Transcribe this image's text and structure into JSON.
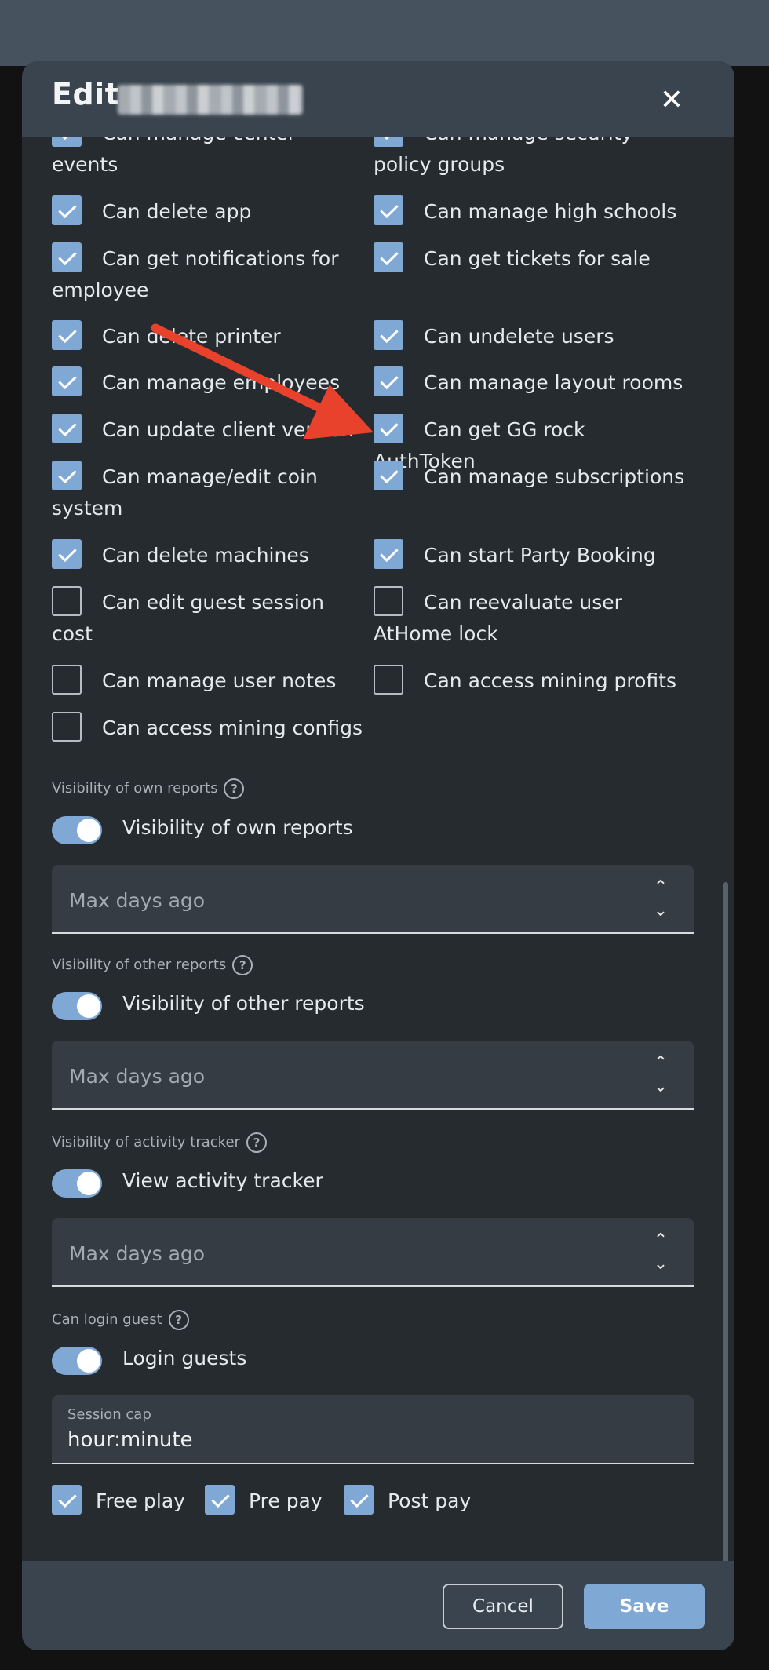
{
  "dialog": {
    "title": "Edit",
    "close_icon": "close-icon"
  },
  "permissions": [
    {
      "label": "Can manage center events",
      "checked": true
    },
    {
      "label": "Can manage security policy groups",
      "checked": true
    },
    {
      "label": "Can delete app",
      "checked": true
    },
    {
      "label": "Can manage high schools",
      "checked": true
    },
    {
      "label": "Can get notifications for employee",
      "checked": true
    },
    {
      "label": "Can get tickets for sale",
      "checked": true
    },
    {
      "label": "Can delete printer",
      "checked": true
    },
    {
      "label": "Can undelete users",
      "checked": true
    },
    {
      "label": "Can manage employees",
      "checked": true
    },
    {
      "label": "Can manage layout rooms",
      "checked": true
    },
    {
      "label": "Can update client version",
      "checked": true
    },
    {
      "label": "Can get GG rock AuthToken",
      "checked": true
    },
    {
      "label": "Can manage/edit coin system",
      "checked": true
    },
    {
      "label": "Can manage subscriptions",
      "checked": true
    },
    {
      "label": "Can delete machines",
      "checked": true
    },
    {
      "label": "Can start Party Booking",
      "checked": true
    },
    {
      "label": "Can edit guest session cost",
      "checked": false
    },
    {
      "label": "Can reevaluate user AtHome lock",
      "checked": false
    },
    {
      "label": "Can manage user notes",
      "checked": false
    },
    {
      "label": "Can access mining profits",
      "checked": false
    },
    {
      "label": "Can access mining configs",
      "checked": false
    }
  ],
  "sections": {
    "own_reports": {
      "label": "Visibility of own reports",
      "toggle_label": "Visibility of own reports",
      "enabled": true,
      "placeholder": "Max days ago"
    },
    "other_reports": {
      "label": "Visibility of other reports",
      "toggle_label": "Visibility of other reports",
      "enabled": true,
      "placeholder": "Max days ago"
    },
    "activity_tracker": {
      "label": "Visibility of activity tracker",
      "toggle_label": "View activity tracker",
      "enabled": true,
      "placeholder": "Max days ago"
    },
    "login_guest": {
      "label": "Can login guest",
      "toggle_label": "Login guests",
      "enabled": true,
      "session_cap_label": "Session cap",
      "session_cap_value": "hour:minute"
    }
  },
  "help_glyph": "?",
  "payment_options": [
    {
      "label": "Free play",
      "checked": true
    },
    {
      "label": "Pre pay",
      "checked": true
    },
    {
      "label": "Post pay",
      "checked": true
    }
  ],
  "footer": {
    "cancel_label": "Cancel",
    "save_label": "Save"
  },
  "colors": {
    "accent": "#7fa9d4",
    "annotation_arrow": "#e8412c",
    "dialog_bg": "#262b30",
    "header_bg": "#3a444e"
  },
  "annotation": {
    "type": "arrow",
    "target": "Can get GG rock AuthToken"
  }
}
